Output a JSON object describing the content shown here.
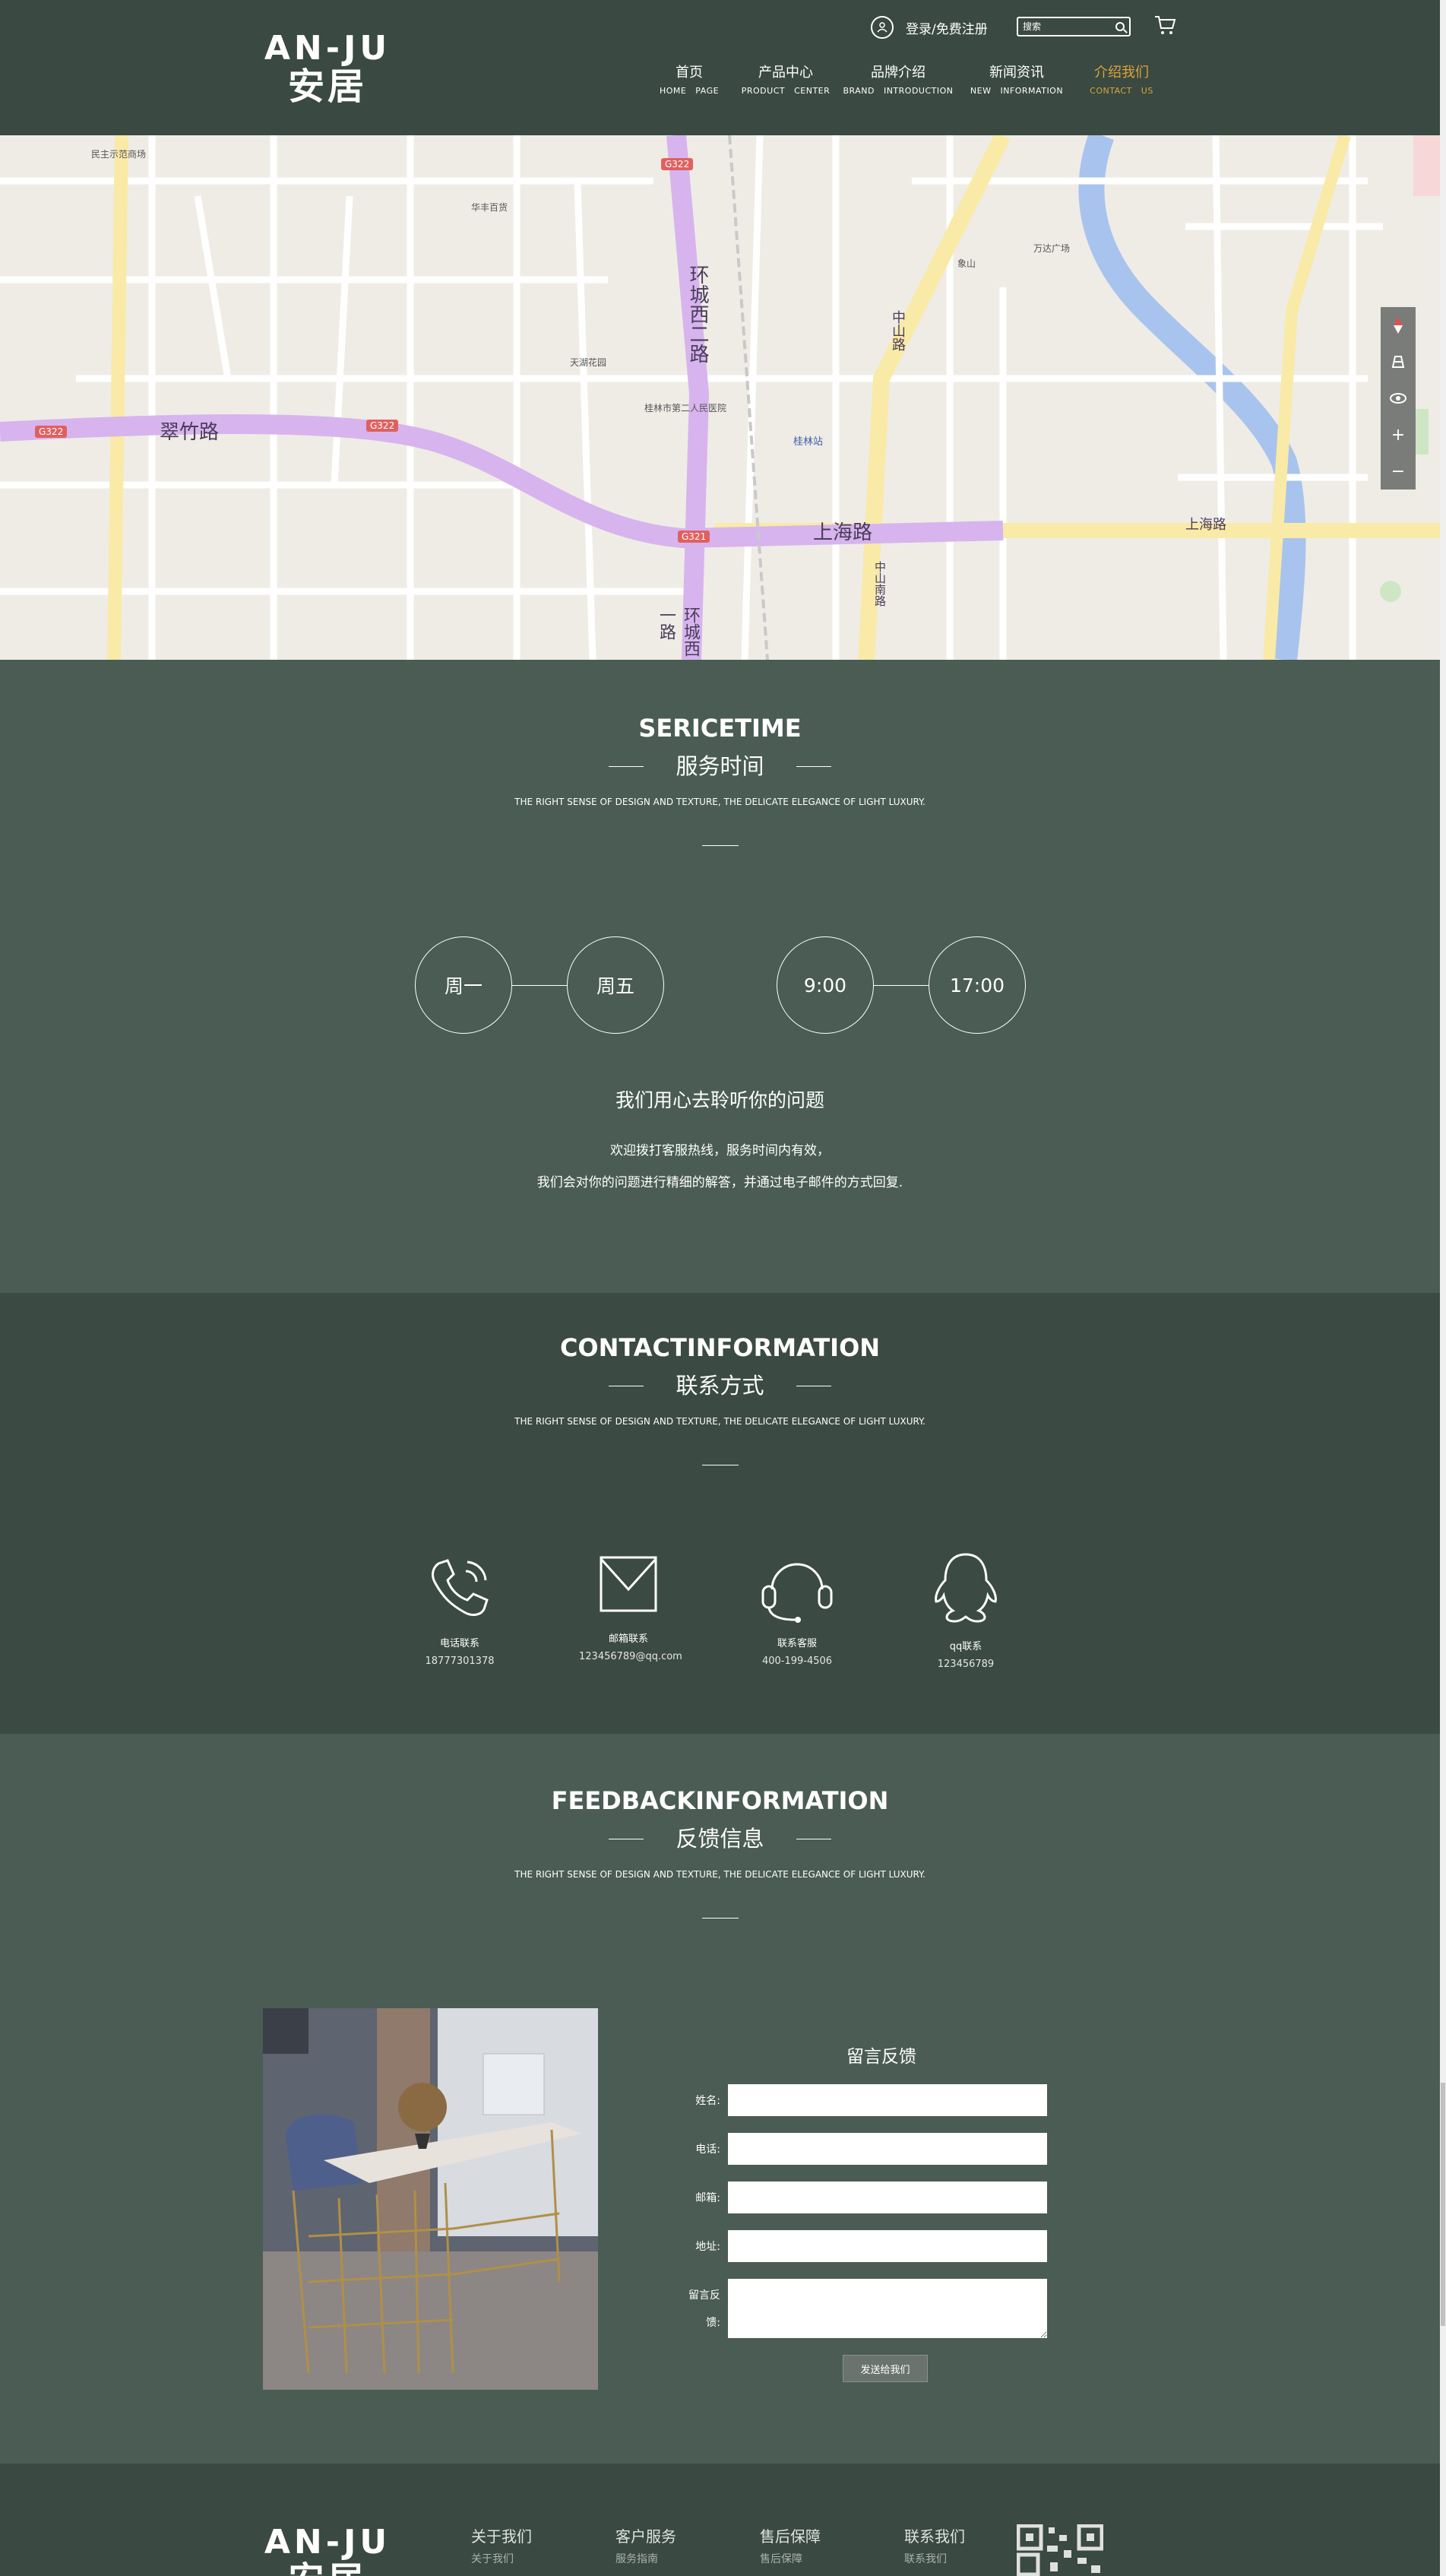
{
  "brand": {
    "logo_en": "AN-JU",
    "logo_cn": "安居"
  },
  "header": {
    "login_text": "登录/免费注册",
    "search_placeholder": "搜索",
    "nav": [
      {
        "cn": "首页",
        "en": "HOME PAGE"
      },
      {
        "cn": "产品中心",
        "en": "PRODUCT CENTER"
      },
      {
        "cn": "品牌介绍",
        "en": "BRAND INTRODUCTION"
      },
      {
        "cn": "新闻资讯",
        "en": "NEW INFORMATION"
      },
      {
        "cn": "介绍我们",
        "en": "CONTACT US",
        "active": true
      }
    ],
    "accent_color": "#d9a53b"
  },
  "map": {
    "labels": {
      "road_cuizhu": "翠竹路",
      "road_shanghai": "上海路",
      "road_shanghai2": "上海路",
      "road_huancheng": "环城西一路",
      "road_huancheng2": "环城西二路",
      "road_zhongshan": "中山路",
      "road_zhongshan2": "中山南路",
      "badge_g322_a": "G322",
      "badge_g322_b": "G322",
      "badge_g322_c": "G322",
      "badge_g321": "G321",
      "poi_station": "桂林站",
      "poi_1": "民主示范商场",
      "poi_2": "华丰百货",
      "poi_3": "桂林市第二人民医院",
      "poi_4": "天湖花园",
      "poi_5": "象山",
      "poi_6": "万达广场"
    },
    "controls": [
      "compass-icon",
      "layers-icon",
      "eye-icon",
      "zoom-in-icon",
      "zoom-out-icon"
    ]
  },
  "service": {
    "title_en": "SERICETIME",
    "title_cn": "服务时间",
    "subtitle": "THE RIGHT SENSE OF DESIGN AND TEXTURE, THE DELICATE ELEGANCE OF LIGHT LUXURY.",
    "day_start": "周一",
    "day_end": "周五",
    "time_start": "9:00",
    "time_end": "17:00",
    "heading": "我们用心去聆听你的问题",
    "text_line1": "欢迎拨打客服热线，服务时间内有效，",
    "text_line2": "我们会对你的问题进行精细的解答，并通过电子邮件的方式回复."
  },
  "contact": {
    "title_en": "CONTACTINFORMATION",
    "title_cn": "联系方式",
    "subtitle": "THE RIGHT SENSE OF DESIGN AND TEXTURE, THE DELICATE ELEGANCE OF LIGHT LUXURY.",
    "items": [
      {
        "label": "电话联系",
        "value": "18777301378",
        "icon": "phone-icon"
      },
      {
        "label": "邮箱联系",
        "value": "123456789@qq.com",
        "icon": "mail-icon"
      },
      {
        "label": "联系客服",
        "value": "400-199-4506",
        "icon": "headset-icon"
      },
      {
        "label": "qq联系",
        "value": "123456789",
        "icon": "qq-icon"
      }
    ]
  },
  "feedback": {
    "title_en": "FEEDBACKINFORMATION",
    "title_cn": "反馈信息",
    "subtitle": "THE RIGHT SENSE OF DESIGN AND TEXTURE, THE DELICATE ELEGANCE OF LIGHT LUXURY.",
    "form_title": "留言反馈",
    "fields": {
      "name": "姓名:",
      "phone": "电话:",
      "email": "邮箱:",
      "address": "地址:",
      "message_line1": "留言反",
      "message_line2": "馈:"
    },
    "submit": "发送给我们"
  },
  "footer": {
    "cols": [
      {
        "h": "关于我们",
        "s": "关于我们"
      },
      {
        "h": "客户服务",
        "s": "服务指南"
      },
      {
        "h": "售后保障",
        "s": "售后保障"
      },
      {
        "h": "联系我们",
        "s": "联系我们"
      }
    ]
  }
}
